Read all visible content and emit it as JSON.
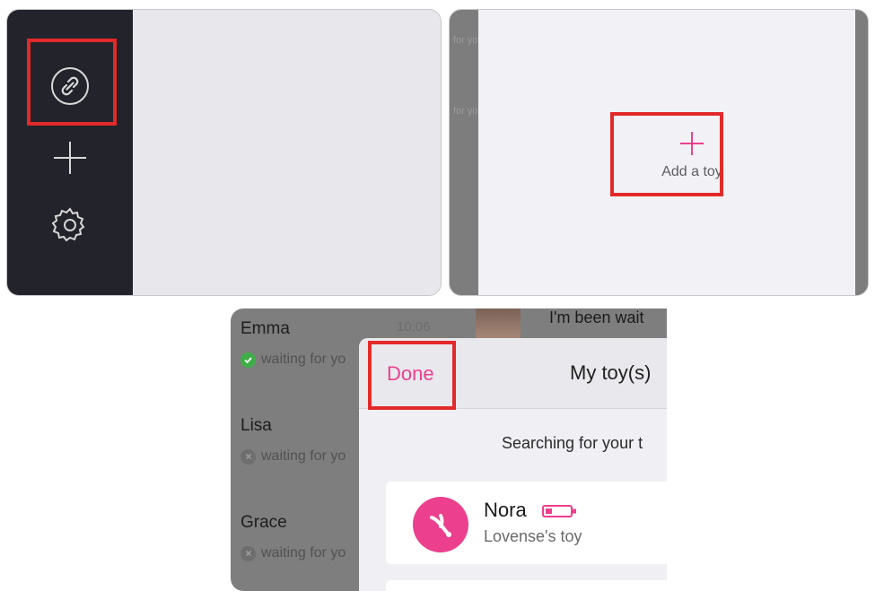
{
  "panel_sidebar": {
    "icons": [
      "link-icon",
      "plus-icon",
      "gear-icon"
    ],
    "colors": {
      "sidebar_bg": "#23232b",
      "content_bg": "#e8e7ec",
      "highlight": "#e22a2a"
    }
  },
  "panel_add": {
    "ghost_text": [
      "for yo",
      "for yo"
    ],
    "add_toy_label": "Add a toy",
    "colors": {
      "accent": "#ec3f8e"
    }
  },
  "panel_toys": {
    "contacts": [
      {
        "name": "Emma",
        "status": "waiting for yo",
        "online": true
      },
      {
        "name": "Lisa",
        "status": "waiting for yo",
        "online": false
      },
      {
        "name": "Grace",
        "status": "waiting for yo",
        "online": false
      }
    ],
    "first_time": "10:06",
    "chat_bubble": "I'm been wait",
    "modal": {
      "done_label": "Done",
      "title": "My toy(s)",
      "searching": "Searching for your t"
    },
    "toy": {
      "name": "Nora",
      "subtitle": "Lovense's toy",
      "icon": "toy-icon",
      "battery_icon": "battery-low-icon"
    },
    "colors": {
      "accent": "#ec3f8e",
      "online": "#3fae49",
      "offline": "#6e6e6e"
    }
  }
}
